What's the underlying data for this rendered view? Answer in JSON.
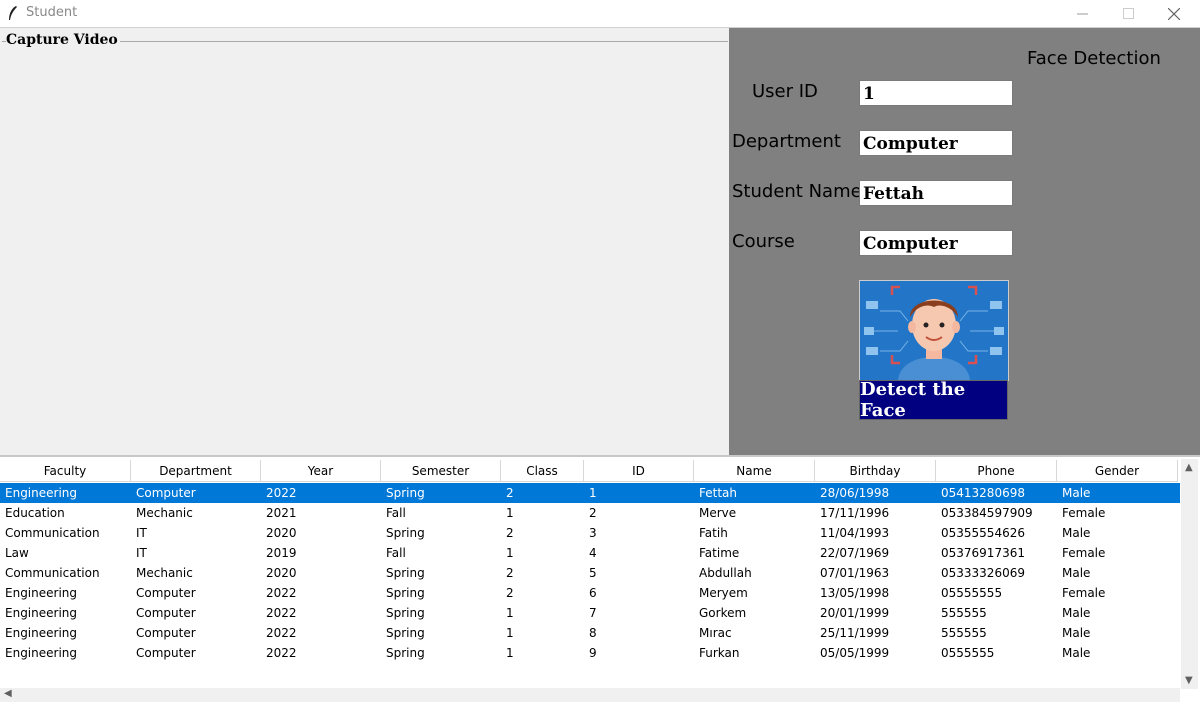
{
  "window": {
    "title": "Student",
    "icon": "feather-icon"
  },
  "capture": {
    "legend": "Capture Video"
  },
  "panel": {
    "heading": "Face Detection",
    "fields": [
      {
        "label": "User ID",
        "value": "1"
      },
      {
        "label": "Department",
        "value": "Computer"
      },
      {
        "label": "Student Name",
        "value": "Fettah"
      },
      {
        "label": "Course",
        "value": "Computer"
      }
    ],
    "detect_button": "Detect the Face",
    "image": "face-scan-illustration"
  },
  "table": {
    "columns": [
      "Faculty",
      "Department",
      "Year",
      "Semester",
      "Class",
      "ID",
      "Name",
      "Birthday",
      "Phone",
      "Gender"
    ],
    "selected_row": 0,
    "rows": [
      [
        "Engineering",
        "Computer",
        "2022",
        "Spring",
        "2",
        "1",
        "Fettah",
        "28/06/1998",
        "05413280698",
        "Male"
      ],
      [
        "Education",
        "Mechanic",
        "2021",
        "Fall",
        "1",
        "2",
        "Merve",
        "17/11/1996",
        "053384597909",
        "Female"
      ],
      [
        "Communication",
        "IT",
        "2020",
        "Spring",
        "2",
        "3",
        "Fatih",
        "11/04/1993",
        "05355554626",
        "Male"
      ],
      [
        "Law",
        "IT",
        "2019",
        "Fall",
        "1",
        "4",
        "Fatime",
        "22/07/1969",
        "05376917361",
        "Female"
      ],
      [
        "Communication",
        "Mechanic",
        "2020",
        "Spring",
        "2",
        "5",
        "Abdullah",
        "07/01/1963",
        "05333326069",
        "Male"
      ],
      [
        "Engineering",
        "Computer",
        "2022",
        "Spring",
        "2",
        "6",
        "Meryem",
        "13/05/1998",
        "05555555",
        "Female"
      ],
      [
        "Engineering",
        "Computer",
        "2022",
        "Spring",
        "1",
        "7",
        "Gorkem",
        "20/01/1999",
        "555555",
        "Male"
      ],
      [
        "Engineering",
        "Computer",
        "2022",
        "Spring",
        "1",
        "8",
        "Mırac",
        "25/11/1999",
        "555555",
        "Male"
      ],
      [
        "Engineering",
        "Computer",
        "2022",
        "Spring",
        "1",
        "9",
        "Furkan",
        "05/05/1999",
        "0555555",
        "Male"
      ]
    ]
  },
  "colors": {
    "selection": "#0078d7",
    "panel": "#808080",
    "button": "#000080"
  }
}
